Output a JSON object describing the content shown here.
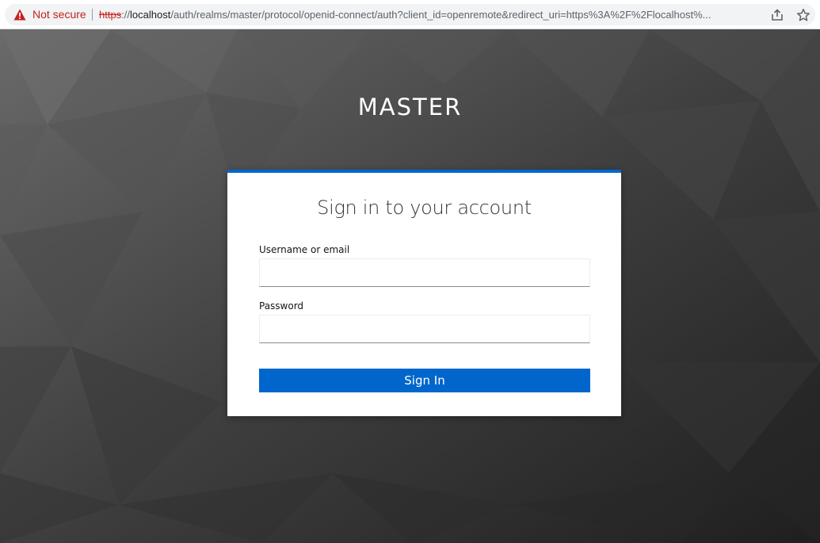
{
  "browser": {
    "security_label": "Not secure",
    "url_scheme": "https",
    "url_scheme_sep": "://",
    "url_host": "localhost",
    "url_rest": "/auth/realms/master/protocol/openid-connect/auth?client_id=openremote&redirect_uri=https%3A%2F%2Flocalhost%...",
    "icons": [
      "warning-icon",
      "share-icon",
      "star-icon"
    ]
  },
  "page": {
    "realm_title": "MASTER",
    "card": {
      "title": "Sign in to your account",
      "username_label": "Username or email",
      "username_value": "",
      "password_label": "Password",
      "password_value": "",
      "submit_label": "Sign In"
    }
  },
  "colors": {
    "accent": "#0066cc",
    "warning": "#c5221f",
    "card_background": "#ffffff"
  }
}
